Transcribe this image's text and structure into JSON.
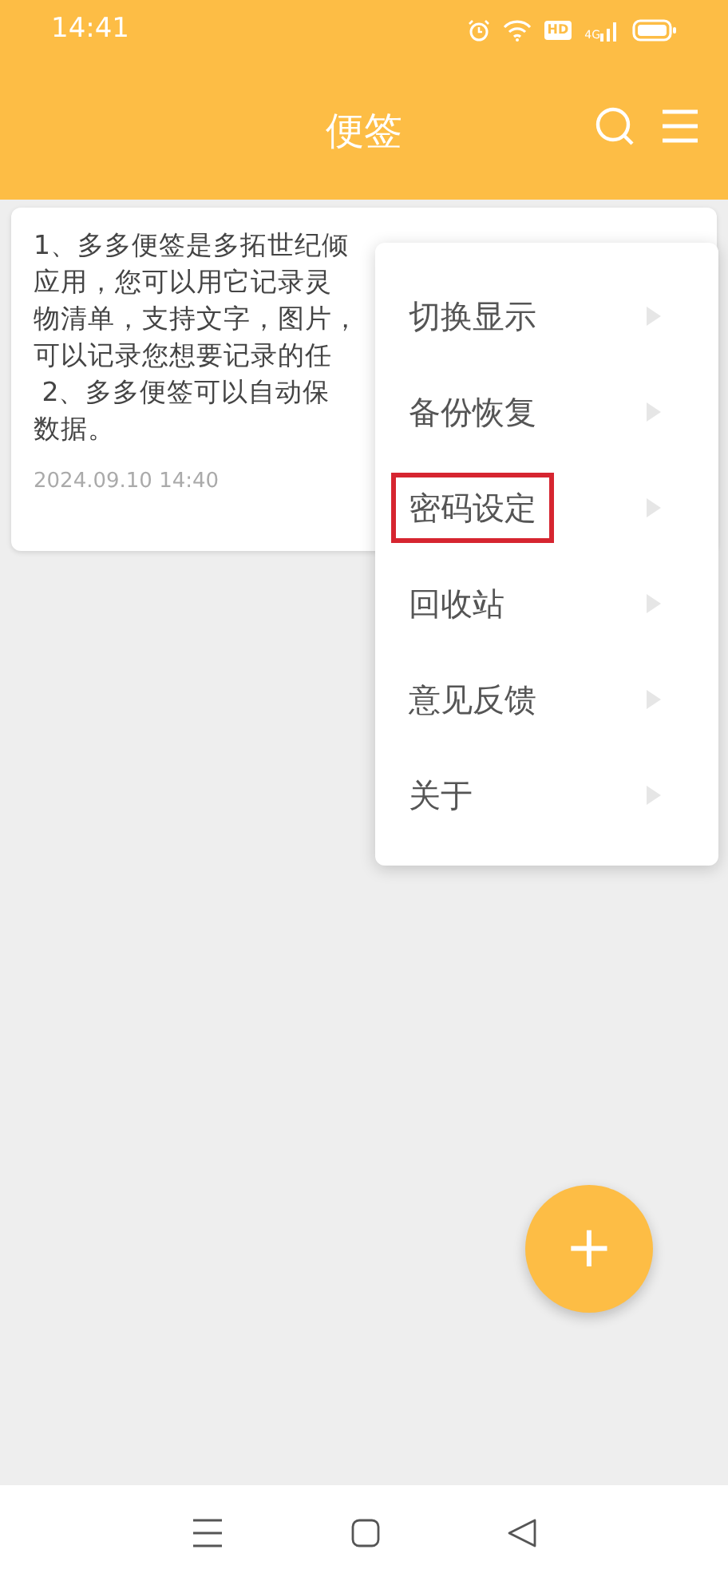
{
  "status_bar": {
    "time": "14:41",
    "hd_badge": "HD",
    "network": "4G"
  },
  "header": {
    "title": "便签"
  },
  "notes": [
    {
      "lines": [
        "1、多多便签是多拓世纪倾",
        "应用，您可以用它记录灵",
        "物清单，支持文字，图片，",
        "可以记录您想要记录的任",
        " 2、多多便签可以自动保",
        "数据。"
      ],
      "date": "2024.09.10 14:40"
    }
  ],
  "menu": {
    "items": [
      {
        "label": "切换显示",
        "selected": false
      },
      {
        "label": "备份恢复",
        "selected": false
      },
      {
        "label": "密码设定",
        "selected": true
      },
      {
        "label": "回收站",
        "selected": false
      },
      {
        "label": "意见反馈",
        "selected": false
      },
      {
        "label": "关于",
        "selected": false
      }
    ]
  },
  "fab": {
    "label": "+"
  }
}
